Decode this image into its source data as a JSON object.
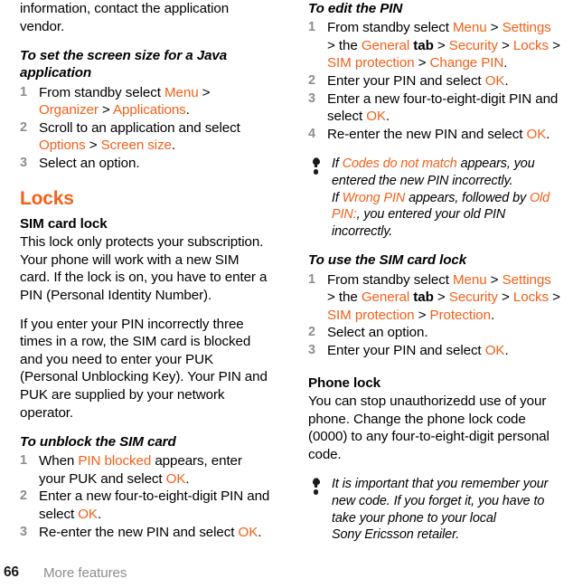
{
  "meta": {
    "accent_color": "#F4601A",
    "muted_color": "#8d8d8d",
    "text_color": "#000000"
  },
  "footer": {
    "page_number": "66",
    "chapter": "More features"
  },
  "left_column": {
    "continued_paragraph": {
      "text": "information, contact the application vendor."
    },
    "procedure_java_screen_size": {
      "heading": "To set the screen size for a Java application",
      "steps": [
        {
          "runs": [
            {
              "t": "From standby select ",
              "style": "plain"
            },
            {
              "t": "Menu",
              "style": "ui"
            },
            {
              "t": " > ",
              "style": "plain"
            },
            {
              "t": "Organizer",
              "style": "ui"
            },
            {
              "t": " > ",
              "style": "plain"
            },
            {
              "t": "Applications",
              "style": "ui"
            },
            {
              "t": ".",
              "style": "plain"
            }
          ]
        },
        {
          "runs": [
            {
              "t": "Scroll to an application and select ",
              "style": "plain"
            },
            {
              "t": "Options",
              "style": "ui"
            },
            {
              "t": " > ",
              "style": "plain"
            },
            {
              "t": "Screen size",
              "style": "ui"
            },
            {
              "t": ".",
              "style": "plain"
            }
          ]
        },
        {
          "runs": [
            {
              "t": "Select an option.",
              "style": "plain"
            }
          ]
        }
      ]
    },
    "section_heading": "Locks",
    "sim_card_lock": {
      "heading": "SIM card lock",
      "paragraph_1": "This lock only protects your subscription. Your phone will work with a new SIM card. If the lock is on, you have to enter a PIN (Personal Identity Number).",
      "paragraph_2": "If you enter your PIN incorrectly three times in a row, the SIM card is blocked and you need to enter your PUK (Personal Unblocking Key). Your PIN and PUK are supplied by your network operator."
    },
    "procedure_unblock_sim": {
      "heading": "To unblock the SIM card",
      "steps": [
        {
          "runs": [
            {
              "t": "When ",
              "style": "plain"
            },
            {
              "t": "PIN blocked",
              "style": "ui"
            },
            {
              "t": " appears, enter your PUK and select ",
              "style": "plain"
            },
            {
              "t": "OK",
              "style": "ui"
            },
            {
              "t": ".",
              "style": "plain"
            }
          ]
        },
        {
          "runs": [
            {
              "t": "Enter a new four-to-eight-digit PIN and select ",
              "style": "plain"
            },
            {
              "t": "OK",
              "style": "ui"
            },
            {
              "t": ".",
              "style": "plain"
            }
          ]
        },
        {
          "runs": [
            {
              "t": "Re-enter the new PIN and select ",
              "style": "plain"
            },
            {
              "t": "OK",
              "style": "ui"
            },
            {
              "t": ".",
              "style": "plain"
            }
          ]
        }
      ]
    }
  },
  "right_column": {
    "procedure_edit_pin": {
      "heading": "To edit the PIN",
      "steps": [
        {
          "runs": [
            {
              "t": "From standby select ",
              "style": "plain"
            },
            {
              "t": "Menu",
              "style": "ui"
            },
            {
              "t": " > ",
              "style": "plain"
            },
            {
              "t": "Settings",
              "style": "ui"
            },
            {
              "t": " > the ",
              "style": "plain"
            },
            {
              "t": "General",
              "style": "ui"
            },
            {
              "t": " tab",
              "style": "bold"
            },
            {
              "t": " > ",
              "style": "plain"
            },
            {
              "t": "Security",
              "style": "ui"
            },
            {
              "t": " > ",
              "style": "plain"
            },
            {
              "t": "Locks",
              "style": "ui"
            },
            {
              "t": " > ",
              "style": "plain"
            },
            {
              "t": "SIM protection",
              "style": "ui"
            },
            {
              "t": " > ",
              "style": "plain"
            },
            {
              "t": "Change PIN",
              "style": "ui"
            },
            {
              "t": ".",
              "style": "plain"
            }
          ]
        },
        {
          "runs": [
            {
              "t": "Enter your PIN and select ",
              "style": "plain"
            },
            {
              "t": "OK",
              "style": "ui"
            },
            {
              "t": ".",
              "style": "plain"
            }
          ]
        },
        {
          "runs": [
            {
              "t": "Enter a new four-to-eight-digit PIN and select ",
              "style": "plain"
            },
            {
              "t": "OK",
              "style": "ui"
            },
            {
              "t": ".",
              "style": "plain"
            }
          ]
        },
        {
          "runs": [
            {
              "t": "Re-enter the new PIN and select ",
              "style": "plain"
            },
            {
              "t": "OK",
              "style": "ui"
            },
            {
              "t": ".",
              "style": "plain"
            }
          ]
        }
      ]
    },
    "note_pin": {
      "icon": "exclamation-icon",
      "runs": [
        {
          "t": "If ",
          "style": "plain"
        },
        {
          "t": "Codes do not match",
          "style": "ui"
        },
        {
          "t": " appears, you entered the new PIN incorrectly.",
          "style": "plain"
        },
        {
          "t": "\n",
          "style": "break"
        },
        {
          "t": "If ",
          "style": "plain"
        },
        {
          "t": "Wrong PIN",
          "style": "ui"
        },
        {
          "t": " appears, followed by ",
          "style": "plain"
        },
        {
          "t": "Old PIN:",
          "style": "ui"
        },
        {
          "t": ", you entered your old PIN incorrectly.",
          "style": "plain"
        }
      ]
    },
    "procedure_use_sim_lock": {
      "heading": "To use the SIM card lock",
      "steps": [
        {
          "runs": [
            {
              "t": "From standby select ",
              "style": "plain"
            },
            {
              "t": "Menu",
              "style": "ui"
            },
            {
              "t": " > ",
              "style": "plain"
            },
            {
              "t": "Settings",
              "style": "ui"
            },
            {
              "t": " > the ",
              "style": "plain"
            },
            {
              "t": "General",
              "style": "ui"
            },
            {
              "t": " tab",
              "style": "bold"
            },
            {
              "t": " > ",
              "style": "plain"
            },
            {
              "t": "Security",
              "style": "ui"
            },
            {
              "t": " > ",
              "style": "plain"
            },
            {
              "t": "Locks",
              "style": "ui"
            },
            {
              "t": " > ",
              "style": "plain"
            },
            {
              "t": "SIM protection",
              "style": "ui"
            },
            {
              "t": " > ",
              "style": "plain"
            },
            {
              "t": "Protection",
              "style": "ui"
            },
            {
              "t": ".",
              "style": "plain"
            }
          ]
        },
        {
          "runs": [
            {
              "t": "Select an option.",
              "style": "plain"
            }
          ]
        },
        {
          "runs": [
            {
              "t": "Enter your PIN and select ",
              "style": "plain"
            },
            {
              "t": "OK",
              "style": "ui"
            },
            {
              "t": ".",
              "style": "plain"
            }
          ]
        }
      ]
    },
    "phone_lock": {
      "heading": "Phone lock",
      "paragraph": "You can stop unauthorizedd use of your phone. Change the phone lock code (0000) to any four-to-eight-digit personal code."
    },
    "note_phone_lock": {
      "icon": "exclamation-icon",
      "runs": [
        {
          "t": "It is important that you remember your new code. If you forget it, you have to take your phone to your local",
          "style": "plain"
        },
        {
          "t": "\n",
          "style": "break"
        },
        {
          "t": "Sony Ericsson retailer.",
          "style": "plain"
        }
      ]
    }
  }
}
